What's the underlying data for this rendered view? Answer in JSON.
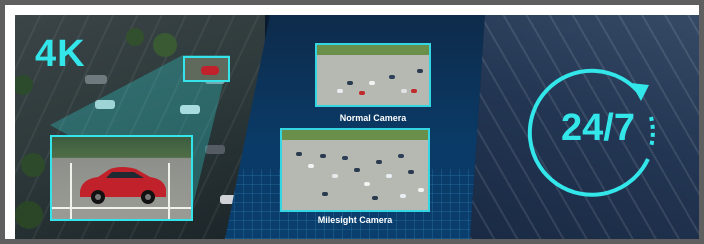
{
  "banner": {
    "left": {
      "label": "4K"
    },
    "middle": {
      "normal_caption": "Normal Camera",
      "milesight_caption": "Milesight Camera"
    },
    "right": {
      "label": "24/7"
    }
  },
  "colors": {
    "accent_cyan": "#32e6ea",
    "frame_gray": "#5f5f5f",
    "car_red": "#c0212a",
    "navy": "#0a3a66"
  },
  "icons": [
    "clock-arrow-icon"
  ]
}
